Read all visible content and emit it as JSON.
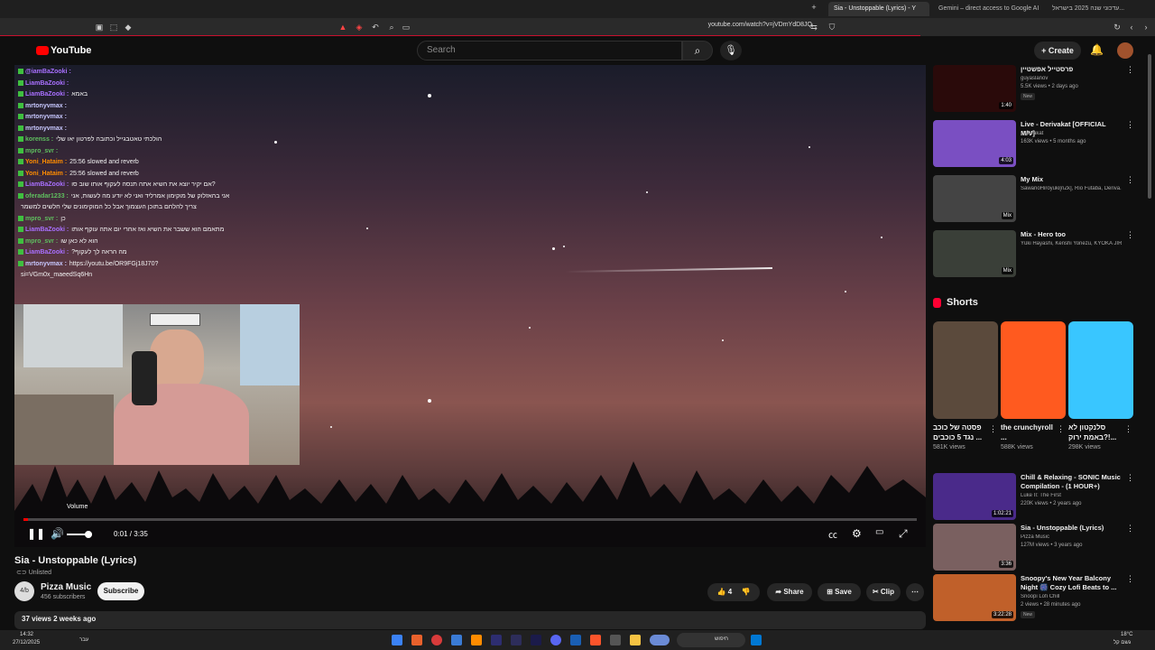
{
  "browser": {
    "tabs": [
      {
        "label": "Sia - Unstoppable (Lyrics) - Y",
        "active": true
      },
      {
        "label": "Gemini – direct access to Google AI",
        "active": false
      },
      {
        "label": "עדכוני שנה 2025 בישראל...",
        "active": false
      }
    ],
    "url": "youtube.com/watch?v=jVDmYdD8JQ"
  },
  "masthead": {
    "logo_text": "YouTube",
    "search_placeholder": "Search",
    "create_label": "Create"
  },
  "chat": [
    {
      "user": "@iamBaZooki :",
      "text": "",
      "color": "#a970ff"
    },
    {
      "user": "LiamBaZooki :",
      "text": "",
      "color": "#a970ff"
    },
    {
      "user": "LiamBaZooki :",
      "text": "באמא",
      "color": "#a970ff"
    },
    {
      "user": "mrtonyvmax :",
      "text": "",
      "color": "#c8c8ff"
    },
    {
      "user": "mrtonyvmax :",
      "text": "",
      "color": "#c8c8ff"
    },
    {
      "user": "mrtonyvmax :",
      "text": "",
      "color": "#c8c8ff"
    },
    {
      "user": "korenss :",
      "text": "הולכתי טאטבגייל וכתובה לפרטון יאו שלי",
      "color": "#5fbf5f"
    },
    {
      "user": "mpro_svr :",
      "text": "",
      "color": "#5fbf5f"
    },
    {
      "user": "Yoni_Hataim :",
      "text": "25:56 slowed and reverb",
      "color": "#ff8c00"
    },
    {
      "user": "Yoni_Hataim :",
      "text": "25:56 slowed and reverb",
      "color": "#ff8c00"
    },
    {
      "user": "LiamBaZooki :",
      "text": "אם יקיר יוצא את השיא אתה תנסה לעקוף אותו שוב סו?",
      "color": "#a970ff"
    },
    {
      "user": "oferadar1233 :",
      "text": "אני בהאזלוק של מוקימון אמרליד ואני לא יודע מה לעשות, אני",
      "color": "#5fbf5f"
    },
    {
      "user": "",
      "text": "צריך להלחם בתוכן העצמוך אבל כל המוקימונים שלי חלשים למשמר",
      "color": "#fff"
    },
    {
      "user": "mpro_svr :",
      "text": "כן",
      "color": "#5fbf5f"
    },
    {
      "user": "LiamBaZooki :",
      "text": "מתאמם הוא ששבר את השיא ואז אחרי יום אתה עוקף אותו",
      "color": "#a970ff"
    },
    {
      "user": "mpro_svr :",
      "text": "הוא לא כאן שו",
      "color": "#5fbf5f"
    },
    {
      "user": "LiamBaZooki :",
      "text": "?מה הראה לך לעקוף",
      "color": "#a970ff"
    },
    {
      "user": "mrtonyvmax :",
      "text": "https://youtu.be/OR9FGj18J70?",
      "color": "#c8c8ff"
    },
    {
      "user": "",
      "text": "si=VGm0x_maeedSq6Hn",
      "color": "#fff"
    }
  ],
  "player": {
    "time": "0:01 / 3:35",
    "progress": 0.005,
    "volume": 0.85,
    "volume_tooltip": "Volume"
  },
  "video": {
    "title": "Sia - Unstoppable (Lyrics)",
    "visibility": "Unlisted",
    "channel": "Pizza Music",
    "channel_avatar_text": "4/b",
    "subscribers": "456 subscribers",
    "subscribe_label": "Subscribe",
    "likes": "4",
    "share_label": "Share",
    "save_label": "Save",
    "clip_label": "Clip",
    "meta": "37 views  2 weeks ago"
  },
  "sidebar": [
    {
      "title": "פרסטייל אפשטיין",
      "channel": "guyaslanov",
      "meta": "5.5K views • 2 days ago",
      "badge": "New",
      "duration": "1:40",
      "thumb": "#2a0a0a"
    },
    {
      "title": "Live - Derivakat [OFFICIAL M/V]",
      "channel": "Derivakat",
      "meta": "163K views • 5 months ago",
      "badge": "",
      "duration": "4:03",
      "thumb": "#7a4fc2"
    },
    {
      "title": "My Mix",
      "channel": "SawanoHiroyuki[nZk], Rio Futaba, Deriva...",
      "meta": "",
      "badge": "",
      "duration": "Mix",
      "thumb": "#444"
    },
    {
      "title": "Mix - Hero too",
      "channel": "Yûki Hayashi, Kenshi Yonezu, KYOKA JIR...",
      "meta": "",
      "badge": "",
      "duration": "Mix",
      "thumb": "#3a3f38"
    }
  ],
  "shorts_heading": "Shorts",
  "shorts": [
    {
      "title": "פסטה של כוכב נגד 5 כוכבים ...",
      "views": "581K views",
      "thumb": "#5b4a3c"
    },
    {
      "title": "the crunchyroll ...",
      "views": "588K views",
      "thumb": "#ff5a1f"
    },
    {
      "title": "סלנקטון לא באמת ירוק?!...",
      "views": "298K views",
      "thumb": "#39c6ff"
    }
  ],
  "sidebar2": [
    {
      "title": "Chill & Relaxing - SONIC Music Compilation - (1 HOUR+)",
      "channel": "Luke II: The First",
      "meta": "220K views • 2 years ago",
      "badge": "",
      "duration": "1:02:21",
      "thumb": "#4a2a8a"
    },
    {
      "title": "Sia - Unstoppable (Lyrics)",
      "channel": "Pizza Music",
      "meta": "127M views • 3 years ago",
      "badge": "",
      "duration": "3:36",
      "thumb": "#7a6060"
    },
    {
      "title": "Snoopy's New Year Balcony Night 🎆 Cozy Lofi Beats to ...",
      "channel": "Snoopi Lofi Chill",
      "meta": "2 views • 28 minutes ago",
      "badge": "New",
      "duration": "3:22:28",
      "thumb": "#c0602a"
    }
  ],
  "taskbar": {
    "time": "14:32",
    "date": "27/12/2025",
    "search_text": "חיפוש",
    "weather": "18°C",
    "weather_sub": "גשם קל",
    "lang": "עבר"
  }
}
